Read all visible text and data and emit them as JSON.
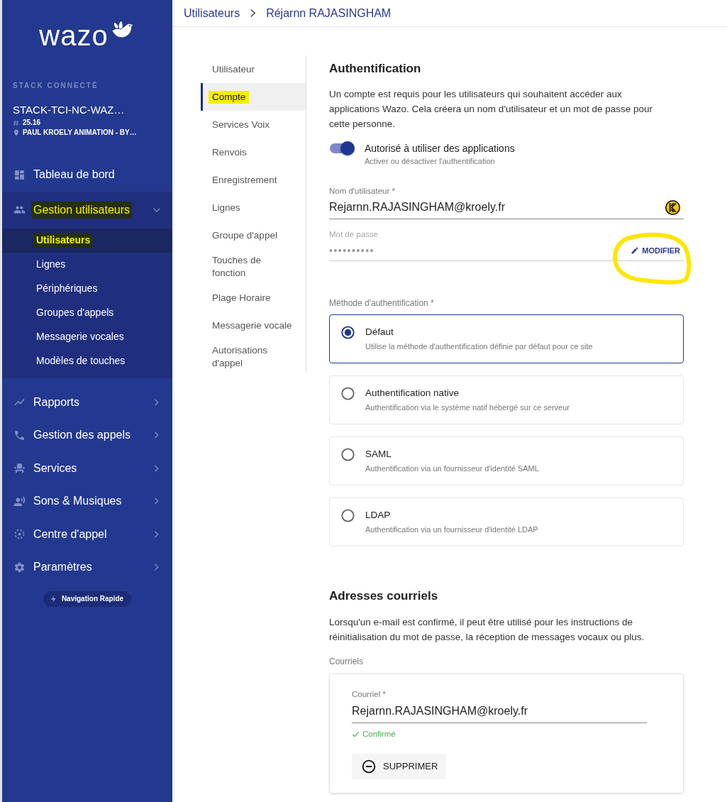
{
  "sidebar": {
    "logo": "wazo",
    "stack": {
      "heading": "STACK CONNECTÉ",
      "name": "STACK-TCI-NC-WAZ…",
      "version": "25.16",
      "location": "PAUL KROELY ANIMATION - BY…"
    },
    "items": [
      {
        "label": "Tableau de bord",
        "kind": "link",
        "selected": false,
        "highlighted": false
      },
      {
        "label": "Gestion utilisateurs",
        "kind": "group",
        "selected": false,
        "expanded": true,
        "highlighted": true,
        "children": [
          {
            "label": "Utilisateurs",
            "selected": true,
            "highlighted": true
          },
          {
            "label": "Lignes",
            "selected": false,
            "highlighted": false
          },
          {
            "label": "Périphériques",
            "selected": false,
            "highlighted": false
          },
          {
            "label": "Groupes d'appels",
            "selected": false,
            "highlighted": false
          },
          {
            "label": "Messagerie vocales",
            "selected": false,
            "highlighted": false
          },
          {
            "label": "Modèles de touches",
            "selected": false,
            "highlighted": false
          }
        ]
      },
      {
        "label": "Rapports",
        "kind": "group",
        "selected": false,
        "expanded": false,
        "highlighted": false
      },
      {
        "label": "Gestion des appels",
        "kind": "group",
        "selected": false,
        "expanded": false,
        "highlighted": false
      },
      {
        "label": "Services",
        "kind": "group",
        "selected": false,
        "expanded": false,
        "highlighted": false
      },
      {
        "label": "Sons & Musiques",
        "kind": "group",
        "selected": false,
        "expanded": false,
        "highlighted": false
      },
      {
        "label": "Centre d'appel",
        "kind": "group",
        "selected": false,
        "expanded": false,
        "highlighted": false
      },
      {
        "label": "Paramètres",
        "kind": "group",
        "selected": false,
        "expanded": false,
        "highlighted": false
      }
    ],
    "quick_nav": "Navigation Rapide"
  },
  "breadcrumb": [
    "Utilisateurs",
    "Réjarnn RAJASINGHAM"
  ],
  "section_nav": [
    {
      "label": "Utilisateur",
      "selected": false,
      "highlighted": false
    },
    {
      "label": "Compte",
      "selected": true,
      "highlighted": true
    },
    {
      "label": "Services Voix",
      "selected": false,
      "highlighted": false
    },
    {
      "label": "Renvois",
      "selected": false,
      "highlighted": false
    },
    {
      "label": "Enregistrement",
      "selected": false,
      "highlighted": false
    },
    {
      "label": "Lignes",
      "selected": false,
      "highlighted": false
    },
    {
      "label": "Groupe d'appel",
      "selected": false,
      "highlighted": false
    },
    {
      "label": "Touches de fonction",
      "selected": false,
      "highlighted": false
    },
    {
      "label": "Plage Horaire",
      "selected": false,
      "highlighted": false
    },
    {
      "label": "Messagerie vocale",
      "selected": false,
      "highlighted": false
    },
    {
      "label": "Autorisations d'appel",
      "selected": false,
      "highlighted": false
    }
  ],
  "authentication": {
    "title": "Authentification",
    "description": "Un compte est requis pour les utilisateurs qui souhaitent accéder aux applications Wazo. Cela créera un nom d'utilisateur et un mot de passe pour cette personne.",
    "toggle": {
      "label": "Autorisé à utiliser des applications",
      "hint": "Activer ou désactiver l'authentification",
      "on": true
    },
    "username": {
      "label": "Nom d'utilisateur *",
      "value": "Rejarnn.RAJASINGHAM@kroely.fr"
    },
    "password": {
      "label": "Mot de passe",
      "value": "••••••••••",
      "action": {
        "label": "MODIFIER",
        "circled": true
      }
    },
    "method": {
      "label": "Méthode d'authentification *",
      "options": [
        {
          "title": "Défaut",
          "description": "Utilise la méthode d'authentification définie par défaut pour ce site",
          "selected": true
        },
        {
          "title": "Authentification native",
          "description": "Authentification via le système natif hébergé sur ce serveur",
          "selected": false
        },
        {
          "title": "SAML",
          "description": "Authentification via un fournisseur d'identité SAML",
          "selected": false
        },
        {
          "title": "LDAP",
          "description": "Authentification via un fournisseur d'identité LDAP",
          "selected": false
        }
      ]
    }
  },
  "emails": {
    "title": "Adresses courriels",
    "description": "Lorsqu'un e-mail est confirmé, il peut être utilisé pour les instructions de réinitialisation du mot de passe, la réception de messages vocaux ou plus.",
    "label": "Courriels",
    "items": [
      {
        "label": "Courriel *",
        "value": "Rejarnn.RAJASINGHAM@kroely.fr",
        "status": "Confirmé",
        "confirmed": true,
        "delete": "SUPPRIMER"
      }
    ]
  }
}
